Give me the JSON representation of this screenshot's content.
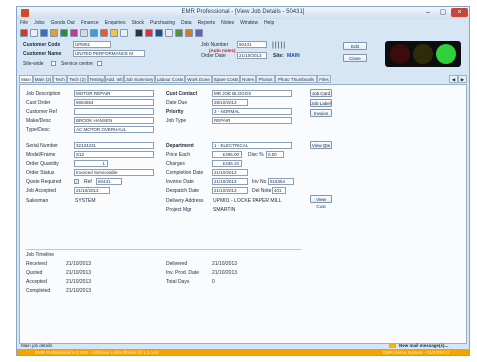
{
  "window": {
    "title": "EMR Professional - [View Job Details - 50431]",
    "minimize": "–",
    "restore": "▢",
    "close": "×"
  },
  "menu": [
    "File",
    "Jobs",
    "Goods Out",
    "Finance",
    "Enquiries",
    "Stock",
    "Purchasing",
    "Data",
    "Reports",
    "Notes",
    "Window",
    "Help"
  ],
  "header": {
    "customer_code_label": "Customer Code",
    "customer_code": "UPM01",
    "customer_name_label": "Customer Name",
    "customer_name": "UNITED PERFORMANCE M",
    "site_wide_label": "Site-wide",
    "service_centre_label": "Service centre",
    "job_number_label": "Job Number",
    "job_number": "50431",
    "auto_notes": "(Auto notes)",
    "order_date_label": "Order Date",
    "order_date": "21/10/2013",
    "site_label": "Site:",
    "site": "MAIN",
    "edit_button": "Edit",
    "close_button": "Close",
    "traffic_colors": [
      "#3a0c0c",
      "#2e2b08",
      "#2fd13a"
    ]
  },
  "tabs": [
    "Main",
    "Main (2)",
    "Tech",
    "Tech (2)",
    "Testing",
    "Add. Info",
    "Job Summary",
    "Labour Costs",
    "Work Done",
    "Spare Costs",
    "Notes",
    "Photos",
    "Photo Thumbnails",
    "Files"
  ],
  "left": [
    {
      "label": "Job Description",
      "value": "MOTOR REPAIR"
    },
    {
      "label": "Cust Order",
      "value": "5654654"
    },
    {
      "label": "Customer Ref",
      "value": ""
    },
    {
      "label": "Make/Desc",
      "value": "BROOK HANSEN"
    },
    {
      "label": "Type/Desc",
      "value": "AC MOTOR OVERHAUL"
    },
    {
      "label": "Serial Number",
      "value": "32134231"
    },
    {
      "label": "Model/Frame",
      "value": "S12"
    },
    {
      "label": "Order Quantity",
      "value": "1"
    },
    {
      "label": "Order Status",
      "value": "Invoiced Serviceable"
    },
    {
      "label": "Quote Required",
      "ref_label": "Ref",
      "value": "50431"
    },
    {
      "label": "Job Accepted",
      "value": "21/10/2013"
    },
    {
      "label": "Salesman",
      "value": "SYSTEM"
    }
  ],
  "right": {
    "cust_contact_label": "Cust Contact",
    "cust_contact": "MR JOE BLOGGS",
    "date_due_label": "Date Due",
    "date_due": "28/10/2013",
    "priority_label": "Priority",
    "priority": "3 - NORMAL",
    "job_type_label": "Job Type",
    "job_type": "REPAIR",
    "department_label": "Department",
    "department": "1 - ELECTRICAL",
    "price_each_label": "Price Each",
    "price_each": "£495.00",
    "disc_label": "Disc %",
    "disc": "0.00",
    "charges_label": "Charges",
    "charges": "£435.10",
    "completion_label": "Completion Date",
    "completion": "21/10/2013",
    "invoice_label": "Invoice Date",
    "invoice": "21/10/2013",
    "inv_no_label": "Inv No",
    "inv_no": "518354",
    "despatch_label": "Despatch Date",
    "despatch": "21/10/2013",
    "del_note_label": "Del Note",
    "del_note": "401",
    "delivery_label": "Delivery Address",
    "delivery": "UPM01 - LOCKE PAPER MILL",
    "project_label": "Project Mgr",
    "project": "SMARTIN",
    "job_card": "Job Card",
    "job_label": "Job Label",
    "invoice_btn": "Invoice",
    "view_qte": "View Qte",
    "view_cust": "View Cust"
  },
  "timeline": {
    "title": "Job Timeline",
    "rows_left": [
      {
        "label": "Received",
        "value": "21/10/2013"
      },
      {
        "label": "Quoted",
        "value": "21/10/2013"
      },
      {
        "label": "Accepted",
        "value": "21/10/2013"
      },
      {
        "label": "Completed",
        "value": "21/10/2013"
      }
    ],
    "rows_right": [
      {
        "label": "Delivered",
        "value": "21/10/2013"
      },
      {
        "label": "Inv. Prod. Date",
        "value": "21/10/2013"
      },
      {
        "label": "Total Days",
        "value": "0"
      }
    ]
  },
  "status": {
    "left": "Main job details",
    "mail": "New mail message(s)..."
  },
  "bottom": {
    "left": "EMR Professional 6.3.10S - Softmine Ltd/Softmine ltd 1.3.144",
    "right": "EMR Demo System - 21/10/2013"
  }
}
